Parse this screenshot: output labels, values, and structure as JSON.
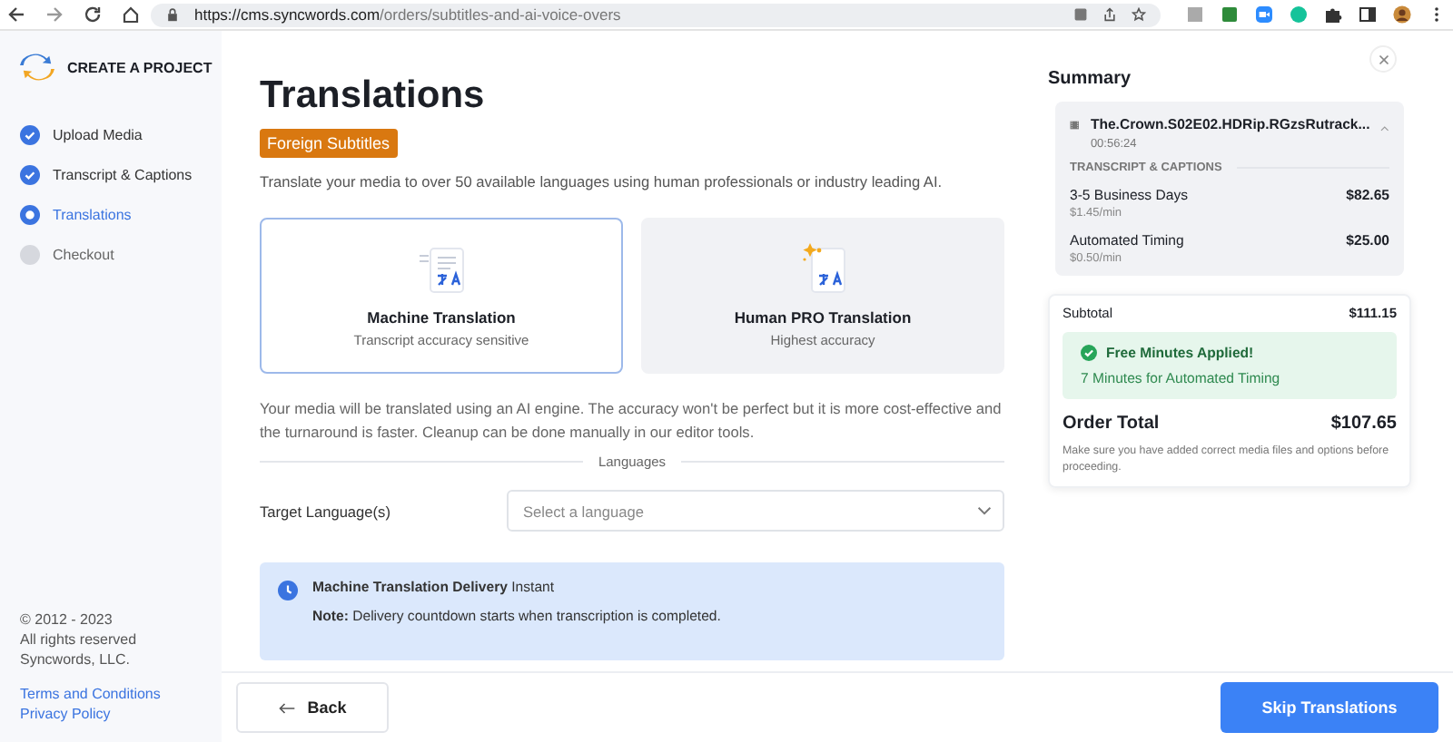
{
  "browser": {
    "url_host": "https://cms.syncwords.com",
    "url_path": "/orders/subtitles-and-ai-voice-overs"
  },
  "sidebar": {
    "title": "CREATE A PROJECT",
    "steps": [
      {
        "label": "Upload Media",
        "kind": "done"
      },
      {
        "label": "Transcript & Captions",
        "kind": "done"
      },
      {
        "label": "Translations",
        "kind": "current"
      },
      {
        "label": "Checkout",
        "kind": "pending"
      }
    ],
    "copyright": [
      "© 2012 - 2023",
      "All rights reserved",
      "Syncwords, LLC."
    ],
    "links": [
      "Terms and Conditions",
      "Privacy Policy"
    ]
  },
  "main": {
    "title": "Translations",
    "badge": "Foreign Subtitles",
    "intro": "Translate your media to over 50 available languages using human professionals or industry leading AI.",
    "options": [
      {
        "kind": "machine",
        "title": "Machine Translation",
        "subtitle": "Transcript accuracy sensitive",
        "selected": true
      },
      {
        "kind": "human",
        "title": "Human PRO Translation",
        "subtitle": "Highest accuracy",
        "selected": false
      }
    ],
    "description": "Your media will be translated using an AI engine. The accuracy won't be perfect but it is more cost-effective and the turnaround is faster. Cleanup can be done manually in our editor tools.",
    "section_label": "Languages",
    "target_label": "Target Language(s)",
    "language_select": {
      "placeholder": "Select a language"
    },
    "delivery": {
      "line": "**Machine Translation Delivery** Instant",
      "note": "**Note:** Delivery countdown starts when transcription is completed."
    }
  },
  "summary": {
    "title": "Summary",
    "file": {
      "name": "The.Crown.S02E02.HDRip.RGzsRutrack...",
      "duration": "00:56:24",
      "expanded": true
    },
    "section": "TRANSCRIPT & CAPTIONS",
    "items": [
      {
        "name": "3-5 Business Days",
        "rate": "$1.45/min",
        "price": "$82.65"
      },
      {
        "name": "Automated Timing",
        "rate": "$0.50/min",
        "price": "$25.00"
      }
    ],
    "subtotal_label": "Subtotal",
    "subtotal": "$111.15",
    "promo": {
      "title": "Free Minutes Applied!",
      "detail": "7 Minutes for Automated Timing"
    },
    "total_label": "Order Total",
    "total": "$107.65",
    "note": "Make sure you have added correct media files and options before proceeding."
  },
  "footer": {
    "back": "Back",
    "next": "Skip Translations"
  }
}
